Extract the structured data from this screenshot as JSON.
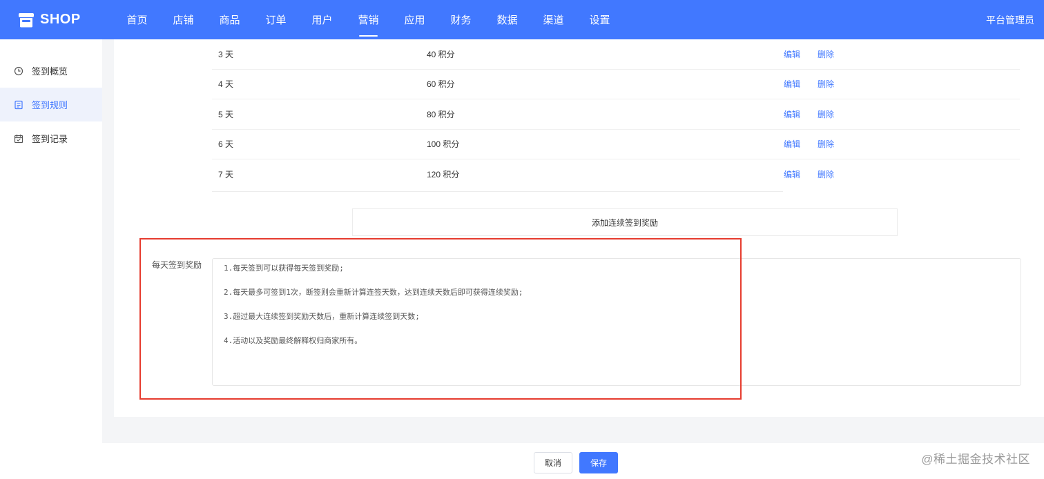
{
  "app": {
    "logo_text": "SHOP",
    "user": "平台管理员"
  },
  "nav": [
    {
      "label": "首页"
    },
    {
      "label": "店铺"
    },
    {
      "label": "商品"
    },
    {
      "label": "订单"
    },
    {
      "label": "用户"
    },
    {
      "label": "营销",
      "active": true
    },
    {
      "label": "应用"
    },
    {
      "label": "财务"
    },
    {
      "label": "数据"
    },
    {
      "label": "渠道"
    },
    {
      "label": "设置"
    }
  ],
  "sidebar": {
    "items": [
      {
        "label": "签到概览",
        "icon": "clock-icon"
      },
      {
        "label": "签到规则",
        "icon": "document-icon",
        "active": true
      },
      {
        "label": "签到记录",
        "icon": "calendar-icon"
      }
    ]
  },
  "rules": {
    "rows": [
      {
        "day": "3 天",
        "points": "40 积分"
      },
      {
        "day": "4 天",
        "points": "60 积分"
      },
      {
        "day": "5 天",
        "points": "80 积分"
      },
      {
        "day": "6 天",
        "points": "100 积分"
      },
      {
        "day": "7 天",
        "points": "120 积分"
      }
    ],
    "edit_label": "编辑",
    "delete_label": "删除",
    "add_label": "添加连续签到奖励"
  },
  "daily": {
    "label": "每天签到奖励",
    "lines": [
      "1.每天签到可以获得每天签到奖励;",
      "2.每天最多可签到1次，断签则会重新计算连签天数，达到连续天数后即可获得连续奖励;",
      "3.超过最大连续签到奖励天数后，重新计算连续签到天数;",
      "4.活动以及奖励最终解释权归商家所有。"
    ]
  },
  "footer": {
    "cancel_label": "取消",
    "save_label": "保存"
  },
  "watermark": "@稀土掘金技术社区",
  "colors": {
    "primary": "#4178ff",
    "highlight": "#e63b2e"
  }
}
